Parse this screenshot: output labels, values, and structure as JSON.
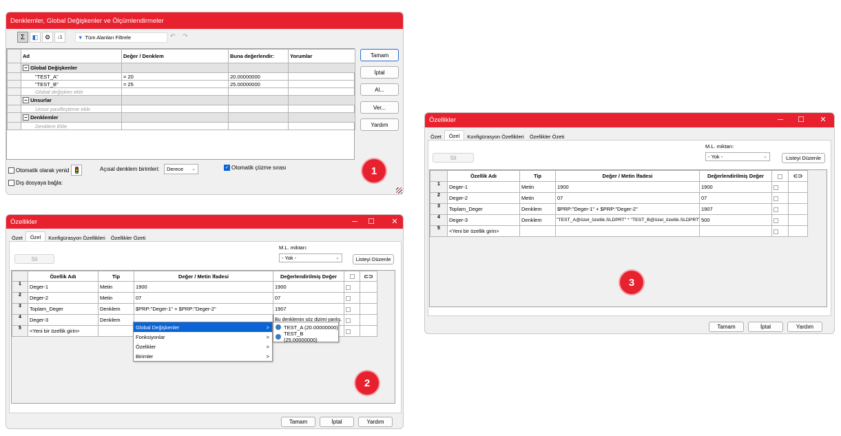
{
  "w1": {
    "title": "Denklemler, Global Değişkenler ve Ölçümlendirmeler",
    "filter_label": "Tüm Alanları Filtrele",
    "toolbar_icons": [
      "sigma-icon",
      "view-icon",
      "ordering-icon",
      "sort-icon"
    ],
    "columns": [
      "Ad",
      "Değer / Denklem",
      "Buna değerlendir:",
      "Yorumlar"
    ],
    "sections": {
      "globals": "Global Değişkenler",
      "g_rows": [
        {
          "name": "\"TEST_A\"",
          "value": "= 20",
          "eval": "20.00000000"
        },
        {
          "name": "\"TEST_B\"",
          "value": "= 25",
          "eval": "25.00000000"
        }
      ],
      "g_add": "Global değişken ekle",
      "features": "Unsurlar",
      "f_add": "Unsur pasifleştirme ekle",
      "equations": "Denklemler",
      "e_add": "Denklem Ekle"
    },
    "buttons": {
      "ok": "Tamam",
      "cancel": "İptal",
      "import": "Al...",
      "export": "Ver...",
      "help": "Yardım"
    },
    "auto_rebuild": "Otomatik olarak yenid",
    "angular_label": "Açısal denklem birimleri:",
    "angular_value": "Derece",
    "auto_solve": "Otomatik çözme sırası",
    "link_external": "Dış dosyaya bağla:",
    "badge": "1"
  },
  "props": {
    "title": "Özellikler",
    "tabs": [
      "Özet",
      "Özel",
      "Konfigürasyon Özellikleri",
      "Özellikler Özeti"
    ],
    "delete": "Sil",
    "bom_label": "M.L. miktarı:",
    "bom_value": "- Yok -",
    "edit_list": "Listeyi Düzenle",
    "columns": [
      "Özellik Adı",
      "Tip",
      "Değer / Metin İfadesi",
      "Değerlendirilmiş Değer"
    ],
    "ok": "Tamam",
    "cancel": "İptal",
    "help": "Yardım"
  },
  "w2": {
    "rows": [
      {
        "idx": "1",
        "name": "Deger-1",
        "type": "Metin",
        "expr": "1900",
        "val": "1900"
      },
      {
        "idx": "2",
        "name": "Deger-2",
        "type": "Metin",
        "expr": "07",
        "val": "07"
      },
      {
        "idx": "3",
        "name": "Toplam_Deger",
        "type": "Denklem",
        "expr": "$PRP:\"Deger-1\" + $PRP:\"Deger-2\"",
        "val": "1907"
      },
      {
        "idx": "4",
        "name": "Deger-3",
        "type": "Denklem",
        "expr": "",
        "val": "Bu denklemin söz dizimi yanlış."
      },
      {
        "idx": "5",
        "name": "<Yeni bir özellik girin>",
        "type": "",
        "expr": "",
        "val": ""
      }
    ],
    "menu": [
      "Global Değişkenler",
      "Fonksiyonlar",
      "Özelikler",
      "Birimler"
    ],
    "submenu": [
      "TEST_A (20.00000000)",
      "TEST_B (25.00000000)"
    ],
    "badge": "2"
  },
  "w3": {
    "rows": [
      {
        "idx": "1",
        "name": "Deger-1",
        "type": "Metin",
        "expr": "1900",
        "val": "1900"
      },
      {
        "idx": "2",
        "name": "Deger-2",
        "type": "Metin",
        "expr": "07",
        "val": "07"
      },
      {
        "idx": "3",
        "name": "Toplam_Deger",
        "type": "Denklem",
        "expr": "$PRP:\"Deger-1\" + $PRP:\"Deger-2\"",
        "val": "1907"
      },
      {
        "idx": "4",
        "name": "Deger-3",
        "type": "Denklem",
        "expr": "\"TEST_A@özel_özellik.SLDPRT\" * \"TEST_B@özel_özellik.SLDPRT\"",
        "val": "500"
      },
      {
        "idx": "5",
        "name": "<Yeni bir özellik girin>",
        "type": "",
        "expr": "",
        "val": ""
      }
    ],
    "badge": "3"
  },
  "colors": {
    "titlebar": "#e8212f",
    "highlight": "#0a64d6"
  }
}
